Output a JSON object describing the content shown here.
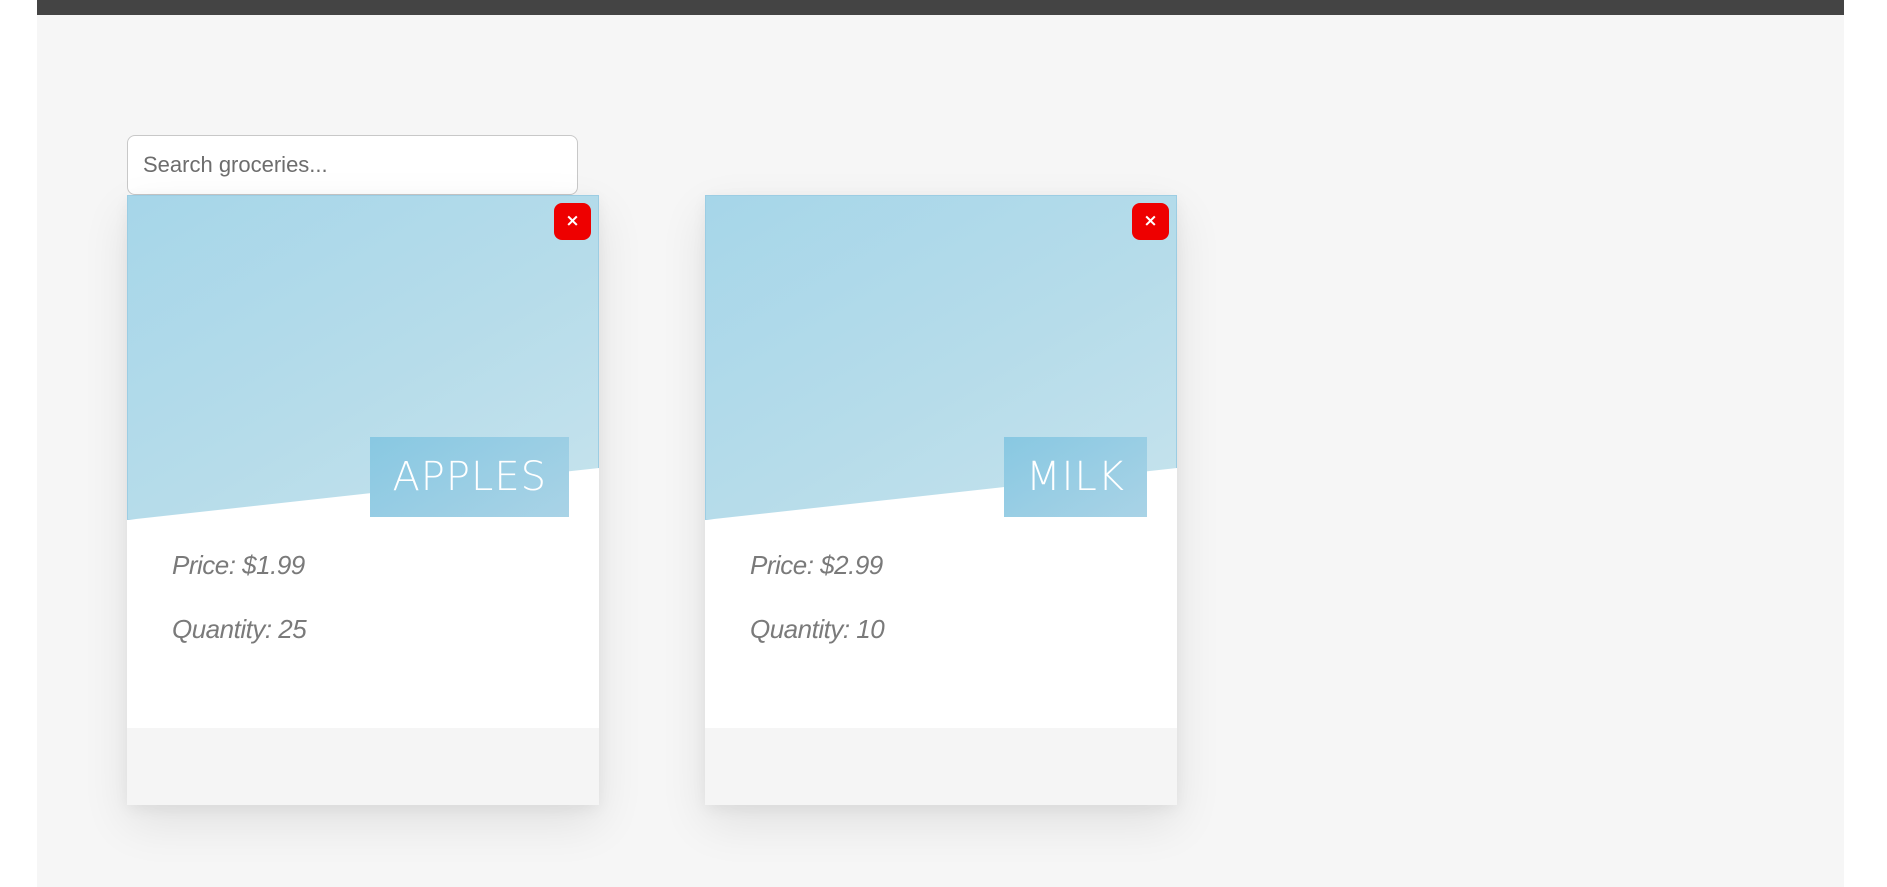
{
  "search": {
    "placeholder": "Search groceries...",
    "value": ""
  },
  "cards": [
    {
      "title": "APPLES",
      "price_text": "Price: $1.99",
      "quantity_text": "Quantity: 25",
      "close_label": "×"
    },
    {
      "title": "MILK",
      "price_text": "Price: $2.99",
      "quantity_text": "Quantity: 10",
      "close_label": "×"
    }
  ],
  "colors": {
    "topbar": "#444444",
    "page_background": "#f6f6f6",
    "card_header": "#a6d6e9",
    "title_badge": "#88c8e2",
    "close_button": "#ee0000",
    "text_muted": "#7a7a7a"
  },
  "icons": {
    "close": "close-icon"
  }
}
